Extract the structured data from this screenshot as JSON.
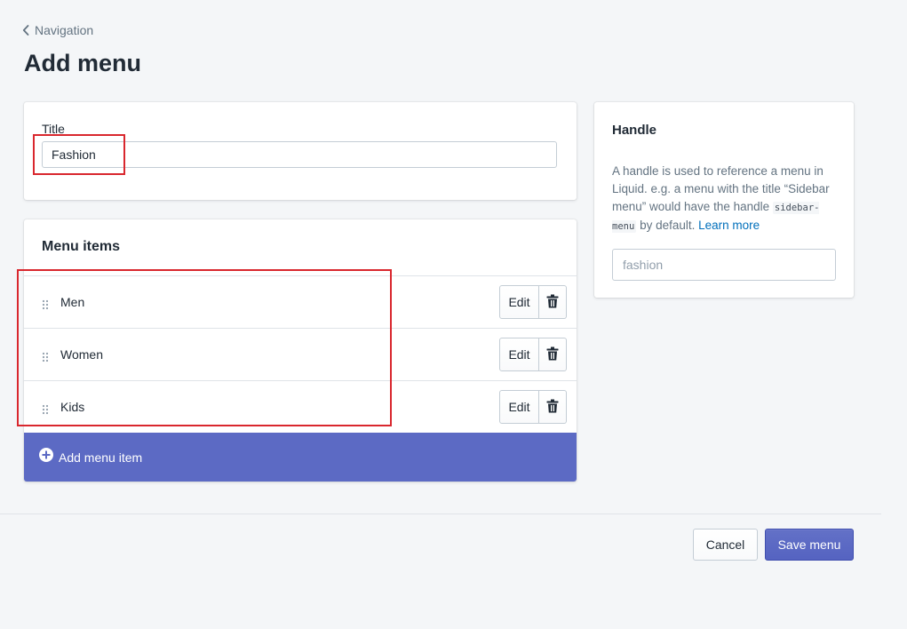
{
  "breadcrumb": {
    "label": "Navigation",
    "icon": "chevron-left-icon"
  },
  "page": {
    "title": "Add menu"
  },
  "title_card": {
    "label": "Title",
    "value": "Fashion"
  },
  "menu_items": {
    "heading": "Menu items",
    "items": [
      {
        "label": "Men",
        "edit_label": "Edit",
        "delete_icon": "trash-icon"
      },
      {
        "label": "Women",
        "edit_label": "Edit",
        "delete_icon": "trash-icon"
      },
      {
        "label": "Kids",
        "edit_label": "Edit",
        "delete_icon": "trash-icon"
      }
    ],
    "add_label": "Add menu item",
    "add_icon": "plus-circle-icon"
  },
  "handle": {
    "heading": "Handle",
    "desc_text": "A handle is used to reference a menu in Liquid. e.g. a menu with the title “Sidebar menu” would have the handle",
    "code": "sidebar-menu",
    "desc_tail": "by default.",
    "link": "Learn more",
    "placeholder": "fashion"
  },
  "footer": {
    "cancel_label": "Cancel",
    "save_label": "Save menu"
  },
  "colors": {
    "accent": "#5c6ac4",
    "background": "#f4f6f8",
    "link": "#006fbb",
    "highlight": "#d9272e"
  }
}
